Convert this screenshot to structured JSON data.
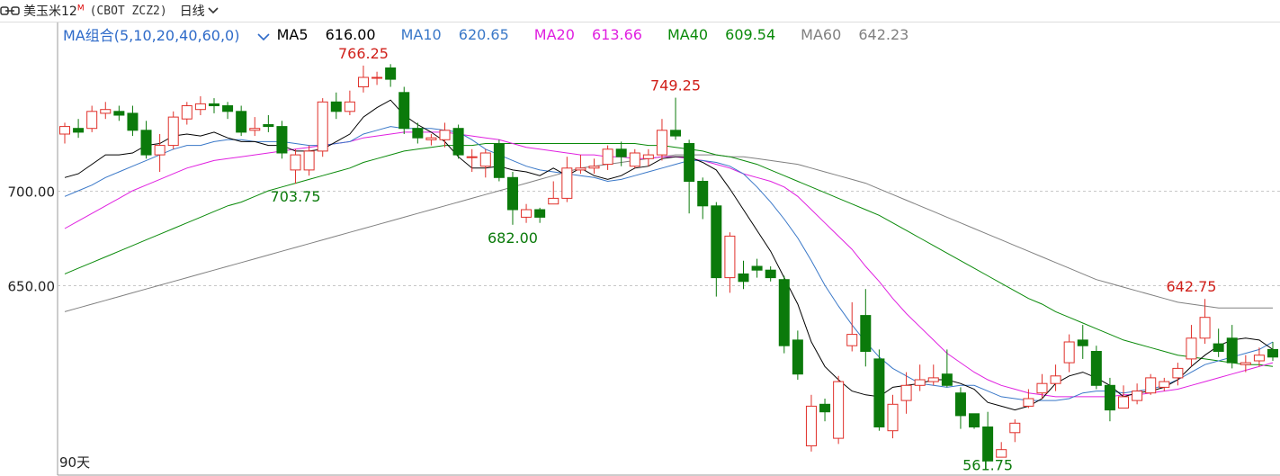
{
  "header": {
    "title": "美玉米12",
    "title_mark": "M",
    "code": "(CBOT ZCZ2)",
    "period": "日线"
  },
  "ma_bar": {
    "combo_label": "MA组合(5,10,20,40,60,0)",
    "items": [
      {
        "label": "MA5",
        "value": "616.00",
        "color": "#000000"
      },
      {
        "label": "MA10",
        "value": "620.65",
        "color": "#3a78c8"
      },
      {
        "label": "MA20",
        "value": "613.66",
        "color": "#e020e0"
      },
      {
        "label": "MA40",
        "value": "609.54",
        "color": "#0a8a0a"
      },
      {
        "label": "MA60",
        "value": "642.23",
        "color": "#808080"
      }
    ]
  },
  "footer": {
    "range_label": "90天"
  },
  "colors": {
    "up": "#e0302a",
    "down": "#0b7a0b",
    "grid": "#c8c8c8"
  },
  "chart_data": {
    "type": "candlestick",
    "y_ticks": [
      {
        "value": 700,
        "label": "700.00"
      },
      {
        "value": 650,
        "label": "650.00"
      }
    ],
    "annotations": [
      {
        "text": "766.25",
        "value": 766.25,
        "index": 22,
        "kind": "high"
      },
      {
        "text": "749.25",
        "value": 749.25,
        "index": 45,
        "kind": "high"
      },
      {
        "text": "703.75",
        "value": 703.75,
        "index": 17,
        "kind": "low"
      },
      {
        "text": "682.00",
        "value": 682.0,
        "index": 33,
        "kind": "low"
      },
      {
        "text": "561.75",
        "value": 561.75,
        "index": 68,
        "kind": "low"
      },
      {
        "text": "642.75",
        "value": 642.75,
        "index": 83,
        "kind": "high"
      }
    ],
    "candles": [
      [
        730,
        734,
        736,
        725
      ],
      [
        733,
        731,
        738,
        728
      ],
      [
        733,
        742,
        745,
        731
      ],
      [
        741,
        743,
        747,
        738
      ],
      [
        742,
        740,
        745,
        737
      ],
      [
        741,
        732,
        745,
        729
      ],
      [
        732,
        719,
        737,
        717
      ],
      [
        719,
        724,
        730,
        710
      ],
      [
        724,
        739,
        742,
        722
      ],
      [
        738,
        745,
        747,
        735
      ],
      [
        743,
        746,
        750,
        740
      ],
      [
        746,
        745,
        749,
        741
      ],
      [
        745,
        742,
        747,
        738
      ],
      [
        742,
        731,
        745,
        729
      ],
      [
        732,
        733,
        739,
        729
      ],
      [
        735,
        734,
        740,
        731
      ],
      [
        734,
        720,
        737,
        717
      ],
      [
        711,
        719,
        722,
        703.75
      ],
      [
        711,
        721,
        724,
        708
      ],
      [
        721,
        747,
        749,
        718
      ],
      [
        747,
        742,
        752,
        738
      ],
      [
        742,
        747,
        753,
        740
      ],
      [
        755,
        760,
        766.25,
        752
      ],
      [
        760,
        760,
        763,
        756
      ],
      [
        765,
        759,
        767,
        755
      ],
      [
        752,
        733,
        755,
        730
      ],
      [
        733,
        728,
        736,
        725
      ],
      [
        727,
        728,
        730,
        724
      ],
      [
        727,
        732,
        736,
        723
      ],
      [
        733,
        719,
        735,
        717
      ],
      [
        718,
        718,
        722,
        710
      ],
      [
        713,
        720,
        722,
        707
      ],
      [
        725,
        707,
        727,
        705
      ],
      [
        707,
        690,
        710,
        682
      ],
      [
        686,
        690,
        693,
        683
      ],
      [
        690,
        686,
        691,
        683
      ],
      [
        693,
        696,
        705,
        693
      ],
      [
        696,
        712,
        718,
        694
      ],
      [
        711,
        712,
        719,
        709
      ],
      [
        712,
        713,
        717,
        709
      ],
      [
        714,
        722,
        724,
        711
      ],
      [
        722,
        718,
        726,
        713
      ],
      [
        713,
        720,
        722,
        712
      ],
      [
        717,
        719,
        722,
        713
      ],
      [
        719,
        732,
        738,
        716
      ],
      [
        732,
        729,
        749.25,
        727
      ],
      [
        725,
        705,
        727,
        688
      ],
      [
        705,
        692,
        707,
        685
      ],
      [
        692,
        654,
        694,
        644
      ],
      [
        654,
        676,
        678,
        646
      ],
      [
        656,
        652,
        663,
        648
      ],
      [
        660,
        658,
        664,
        654
      ],
      [
        658,
        654,
        660,
        652
      ],
      [
        653,
        618,
        655,
        614
      ],
      [
        621,
        603,
        626,
        600
      ],
      [
        565,
        586,
        592,
        562
      ],
      [
        587,
        583,
        590,
        578
      ],
      [
        569,
        599,
        602,
        566
      ],
      [
        618,
        624,
        641,
        615
      ],
      [
        634,
        615,
        648,
        607
      ],
      [
        611,
        575,
        616,
        573
      ],
      [
        573,
        587,
        592,
        569
      ],
      [
        589,
        597,
        604,
        582
      ],
      [
        597,
        600,
        608,
        594
      ],
      [
        599,
        601,
        608,
        597
      ],
      [
        603,
        597,
        616,
        596
      ],
      [
        593,
        581,
        596,
        574
      ],
      [
        582,
        575,
        579,
        574
      ],
      [
        575,
        557,
        583,
        566
      ],
      [
        559,
        563,
        567,
        561.75
      ],
      [
        572,
        577,
        579,
        567
      ],
      [
        586,
        590,
        595,
        585
      ],
      [
        593,
        598,
        603,
        590
      ],
      [
        598,
        602,
        608,
        594
      ],
      [
        609,
        620,
        624,
        604
      ],
      [
        621,
        618,
        629,
        611
      ],
      [
        615,
        597,
        618,
        595
      ],
      [
        597,
        584,
        601,
        578
      ],
      [
        585,
        591,
        597,
        586
      ],
      [
        589,
        594,
        598,
        587
      ],
      [
        593,
        601,
        603,
        592
      ],
      [
        596,
        599,
        601,
        594
      ],
      [
        601,
        606,
        609,
        597
      ],
      [
        611,
        622,
        629,
        607
      ],
      [
        622,
        633,
        642.75,
        619
      ],
      [
        619,
        615,
        627,
        612
      ],
      [
        622,
        609,
        629,
        606
      ],
      [
        608,
        609,
        613,
        604
      ],
      [
        610,
        613,
        617,
        607
      ],
      [
        616,
        612,
        620,
        610
      ]
    ],
    "ma5": [
      707,
      709,
      714,
      719,
      719,
      720,
      724,
      725,
      729,
      730,
      729,
      731,
      728,
      726,
      726,
      724,
      724,
      721,
      721,
      722,
      726,
      730,
      739,
      744,
      748,
      740,
      735,
      731,
      726,
      718,
      712,
      712,
      713,
      711,
      710,
      708,
      712,
      708,
      712,
      708,
      706,
      708,
      712,
      713,
      717,
      718,
      718,
      715,
      711,
      701,
      690,
      679,
      668,
      654,
      640,
      620,
      607,
      600,
      594,
      592,
      591,
      596,
      597,
      598,
      600,
      600,
      598,
      595,
      588,
      586,
      584,
      586,
      590,
      598,
      602,
      604,
      601,
      597,
      591,
      593,
      594,
      596,
      600,
      607,
      613,
      618,
      621,
      622,
      621,
      616
    ],
    "ma10": [
      697,
      700,
      703,
      707,
      710,
      713,
      716,
      719,
      722,
      724,
      724,
      726,
      727,
      727,
      726,
      726,
      726,
      725,
      724,
      724,
      725,
      726,
      730,
      732,
      734,
      733,
      733,
      733,
      732,
      731,
      727,
      722,
      719,
      716,
      713,
      711,
      710,
      709,
      708,
      707,
      705,
      706,
      708,
      710,
      712,
      714,
      716,
      716,
      715,
      713,
      709,
      702,
      694,
      685,
      675,
      663,
      650,
      639,
      629,
      620,
      612,
      606,
      602,
      598,
      597,
      596,
      597,
      597,
      594,
      591,
      590,
      589,
      589,
      589,
      590,
      593,
      594,
      594,
      593,
      594,
      595,
      597,
      600,
      604,
      608,
      610,
      612,
      614,
      616,
      620
    ],
    "ma20": [
      680,
      684,
      688,
      692,
      696,
      700,
      703,
      706,
      709,
      712,
      714,
      716,
      717,
      718,
      719,
      720,
      721,
      722,
      723,
      724,
      725,
      726,
      728,
      729,
      730,
      731,
      731,
      731,
      731,
      730,
      729,
      728,
      727,
      725,
      723,
      722,
      721,
      720,
      719,
      719,
      718,
      718,
      717,
      717,
      718,
      718,
      717,
      716,
      714,
      712,
      709,
      707,
      705,
      702,
      697,
      690,
      683,
      676,
      669,
      660,
      652,
      643,
      635,
      628,
      621,
      614,
      609,
      604,
      600,
      597,
      595,
      593,
      592,
      591,
      591,
      591,
      591,
      591,
      592,
      592,
      593,
      594,
      595,
      597,
      599,
      601,
      603,
      605,
      607,
      609
    ],
    "ma40": [
      656,
      659,
      662,
      665,
      668,
      671,
      674,
      677,
      680,
      683,
      686,
      689,
      692,
      694,
      697,
      700,
      702,
      704,
      706,
      708,
      710,
      712,
      715,
      717,
      719,
      721,
      722,
      723,
      724,
      724,
      724,
      725,
      725,
      725,
      725,
      725,
      725,
      725,
      725,
      725,
      725,
      725,
      725,
      724,
      724,
      723,
      722,
      721,
      719,
      718,
      716,
      714,
      711,
      708,
      705,
      702,
      699,
      696,
      693,
      690,
      687,
      683,
      679,
      675,
      671,
      667,
      663,
      659,
      655,
      651,
      647,
      643,
      640,
      636,
      633,
      630,
      627,
      624,
      621,
      619,
      617,
      615,
      613,
      612,
      611,
      610,
      609,
      608,
      608,
      607
    ],
    "ma60": [
      636,
      638,
      640,
      642,
      644,
      646,
      648,
      650,
      652,
      654,
      656,
      658,
      660,
      662,
      664,
      666,
      668,
      670,
      672,
      674,
      676,
      678,
      680,
      682,
      684,
      686,
      688,
      690,
      692,
      694,
      696,
      698,
      700,
      702,
      704,
      706,
      708,
      710,
      712,
      713,
      714,
      715,
      716,
      717,
      718,
      719,
      719,
      719,
      719,
      718,
      718,
      717,
      716,
      715,
      714,
      712,
      710,
      708,
      706,
      704,
      701,
      698,
      695,
      692,
      689,
      686,
      683,
      680,
      677,
      674,
      671,
      668,
      665,
      662,
      659,
      656,
      653,
      651,
      649,
      647,
      645,
      643,
      641,
      640,
      639,
      638,
      638,
      638,
      638,
      638
    ]
  }
}
